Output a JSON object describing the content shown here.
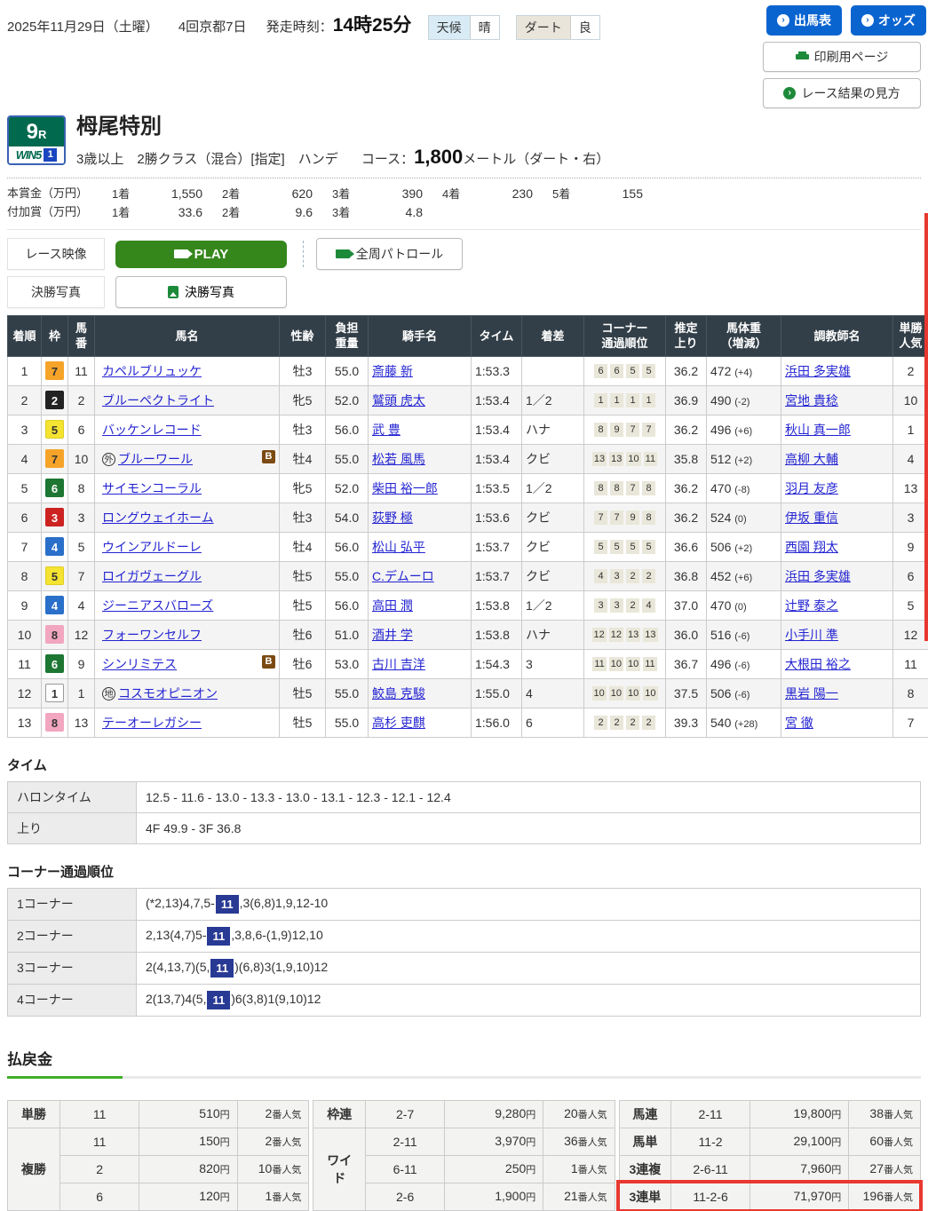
{
  "page": {
    "date": "2025年11月29日（土曜）",
    "meeting": "4回京都7日",
    "start_label": "発走時刻：",
    "start_time": "14時25分",
    "weather_label": "天候",
    "weather_value": "晴",
    "track_label": "ダート",
    "track_value": "良"
  },
  "actions": {
    "entries": "出馬表",
    "odds": "オッズ",
    "print": "印刷用ページ",
    "guide": "レース結果の見方"
  },
  "race": {
    "number": "9",
    "number_suffix": "R",
    "win5": "WIN5",
    "win5_num": "1",
    "title": "栂尾特別",
    "conditions": "3歳以上　2勝クラス（混合）[指定]　ハンデ",
    "course_label": "コース：",
    "course_value": "1,800",
    "course_suffix": "メートル（ダート・右）"
  },
  "prizes": {
    "main_label": "本賞金（万円）",
    "main": [
      [
        "1着",
        "1,550"
      ],
      [
        "2着",
        "620"
      ],
      [
        "3着",
        "390"
      ],
      [
        "4着",
        "230"
      ],
      [
        "5着",
        "155"
      ]
    ],
    "added_label": "付加賞（万円）",
    "added": [
      [
        "1着",
        "33.6"
      ],
      [
        "2着",
        "9.6"
      ],
      [
        "3着",
        "4.8"
      ]
    ]
  },
  "video": {
    "race_video_label": "レース映像",
    "play": "PLAY",
    "patrol": "全周パトロール",
    "photo_label": "決勝写真",
    "photo_button": "決勝写真"
  },
  "results": {
    "headers": [
      "着順",
      "枠",
      "馬\n番",
      "馬名",
      "性齢",
      "負担\n重量",
      "騎手名",
      "タイム",
      "着差",
      "コーナー\n通過順位",
      "推定\n上り",
      "馬体重\n（増減）",
      "調教師名",
      "単勝\n人気"
    ],
    "frame_colors": {
      "1": {
        "bg": "#ffffff",
        "fg": "#333333",
        "border": "#999999"
      },
      "2": {
        "bg": "#222222",
        "fg": "#ffffff",
        "border": "#222222"
      },
      "3": {
        "bg": "#cc2222",
        "fg": "#ffffff",
        "border": "#cc2222"
      },
      "4": {
        "bg": "#2a6fc9",
        "fg": "#ffffff",
        "border": "#2a6fc9"
      },
      "5": {
        "bg": "#f5e332",
        "fg": "#333333",
        "border": "#e0cd20"
      },
      "6": {
        "bg": "#1d7733",
        "fg": "#ffffff",
        "border": "#1d7733"
      },
      "7": {
        "bg": "#f6a429",
        "fg": "#333333",
        "border": "#f6a429"
      },
      "8": {
        "bg": "#f2a6c0",
        "fg": "#333333",
        "border": "#f2a6c0"
      }
    },
    "rows": [
      {
        "pos": "1",
        "frame": "7",
        "num": "11",
        "mark": "",
        "name": "カペルブリュッケ",
        "blinker": false,
        "sex_age": "牡3",
        "weight": "55.0",
        "jockey": "斎藤 新",
        "time": "1:53.3",
        "margin": "",
        "corners": [
          "6",
          "6",
          "5",
          "5"
        ],
        "last3f": "36.2",
        "body": "472",
        "diff": "(+4)",
        "trainer": "浜田 多実雄",
        "pop": "2"
      },
      {
        "pos": "2",
        "frame": "2",
        "num": "2",
        "mark": "",
        "name": "ブルーペクトライト",
        "blinker": false,
        "sex_age": "牝5",
        "weight": "52.0",
        "jockey": "鷲頭 虎太",
        "time": "1:53.4",
        "margin": "1／2",
        "corners": [
          "1",
          "1",
          "1",
          "1"
        ],
        "last3f": "36.9",
        "body": "490",
        "diff": "(-2)",
        "trainer": "宮地 貴稔",
        "pop": "10"
      },
      {
        "pos": "3",
        "frame": "5",
        "num": "6",
        "mark": "",
        "name": "バッケンレコード",
        "blinker": false,
        "sex_age": "牡3",
        "weight": "56.0",
        "jockey": "武 豊",
        "time": "1:53.4",
        "margin": "ハナ",
        "corners": [
          "8",
          "9",
          "7",
          "7"
        ],
        "last3f": "36.2",
        "body": "496",
        "diff": "(+6)",
        "trainer": "秋山 真一郎",
        "pop": "1"
      },
      {
        "pos": "4",
        "frame": "7",
        "num": "10",
        "mark": "外",
        "name": "ブルーワール",
        "blinker": true,
        "sex_age": "牡4",
        "weight": "55.0",
        "jockey": "松若 風馬",
        "time": "1:53.4",
        "margin": "クビ",
        "corners": [
          "13",
          "13",
          "10",
          "11"
        ],
        "last3f": "35.8",
        "body": "512",
        "diff": "(+2)",
        "trainer": "高柳 大輔",
        "pop": "4"
      },
      {
        "pos": "5",
        "frame": "6",
        "num": "8",
        "mark": "",
        "name": "サイモンコーラル",
        "blinker": false,
        "sex_age": "牝5",
        "weight": "52.0",
        "jockey": "柴田 裕一郎",
        "time": "1:53.5",
        "margin": "1／2",
        "corners": [
          "8",
          "8",
          "7",
          "8"
        ],
        "last3f": "36.2",
        "body": "470",
        "diff": "(-8)",
        "trainer": "羽月 友彦",
        "pop": "13"
      },
      {
        "pos": "6",
        "frame": "3",
        "num": "3",
        "mark": "",
        "name": "ロングウェイホーム",
        "blinker": false,
        "sex_age": "牡3",
        "weight": "54.0",
        "jockey": "荻野 極",
        "time": "1:53.6",
        "margin": "クビ",
        "corners": [
          "7",
          "7",
          "9",
          "8"
        ],
        "last3f": "36.2",
        "body": "524",
        "diff": "(0)",
        "trainer": "伊坂 重信",
        "pop": "3"
      },
      {
        "pos": "7",
        "frame": "4",
        "num": "5",
        "mark": "",
        "name": "ウインアルドーレ",
        "blinker": false,
        "sex_age": "牡4",
        "weight": "56.0",
        "jockey": "松山 弘平",
        "time": "1:53.7",
        "margin": "クビ",
        "corners": [
          "5",
          "5",
          "5",
          "5"
        ],
        "last3f": "36.6",
        "body": "506",
        "diff": "(+2)",
        "trainer": "西園 翔太",
        "pop": "9"
      },
      {
        "pos": "8",
        "frame": "5",
        "num": "7",
        "mark": "",
        "name": "ロイガヴェーグル",
        "blinker": false,
        "sex_age": "牡5",
        "weight": "55.0",
        "jockey": "C.デムーロ",
        "time": "1:53.7",
        "margin": "クビ",
        "corners": [
          "4",
          "3",
          "2",
          "2"
        ],
        "last3f": "36.8",
        "body": "452",
        "diff": "(+6)",
        "trainer": "浜田 多実雄",
        "pop": "6"
      },
      {
        "pos": "9",
        "frame": "4",
        "num": "4",
        "mark": "",
        "name": "ジーニアスバローズ",
        "blinker": false,
        "sex_age": "牡5",
        "weight": "56.0",
        "jockey": "高田 潤",
        "time": "1:53.8",
        "margin": "1／2",
        "corners": [
          "3",
          "3",
          "2",
          "4"
        ],
        "last3f": "37.0",
        "body": "470",
        "diff": "(0)",
        "trainer": "辻野 泰之",
        "pop": "5"
      },
      {
        "pos": "10",
        "frame": "8",
        "num": "12",
        "mark": "",
        "name": "フォーワンセルフ",
        "blinker": false,
        "sex_age": "牡6",
        "weight": "51.0",
        "jockey": "酒井 学",
        "time": "1:53.8",
        "margin": "ハナ",
        "corners": [
          "12",
          "12",
          "13",
          "13"
        ],
        "last3f": "36.0",
        "body": "516",
        "diff": "(-6)",
        "trainer": "小手川 準",
        "pop": "12"
      },
      {
        "pos": "11",
        "frame": "6",
        "num": "9",
        "mark": "",
        "name": "シンリミテス",
        "blinker": true,
        "sex_age": "牡6",
        "weight": "53.0",
        "jockey": "古川 吉洋",
        "time": "1:54.3",
        "margin": "3",
        "corners": [
          "11",
          "10",
          "10",
          "11"
        ],
        "last3f": "36.7",
        "body": "496",
        "diff": "(-6)",
        "trainer": "大根田 裕之",
        "pop": "11"
      },
      {
        "pos": "12",
        "frame": "1",
        "num": "1",
        "mark": "地",
        "name": "コスモオピニオン",
        "blinker": false,
        "sex_age": "牡5",
        "weight": "55.0",
        "jockey": "鮫島 克駿",
        "time": "1:55.0",
        "margin": "4",
        "corners": [
          "10",
          "10",
          "10",
          "10"
        ],
        "last3f": "37.5",
        "body": "506",
        "diff": "(-6)",
        "trainer": "黒岩 陽一",
        "pop": "8"
      },
      {
        "pos": "13",
        "frame": "8",
        "num": "13",
        "mark": "",
        "name": "テーオーレガシー",
        "blinker": false,
        "sex_age": "牡5",
        "weight": "55.0",
        "jockey": "高杉 吏麒",
        "time": "1:56.0",
        "margin": "6",
        "corners": [
          "2",
          "2",
          "2",
          "2"
        ],
        "last3f": "39.3",
        "body": "540",
        "diff": "(+28)",
        "trainer": "宮 徹",
        "pop": "7"
      }
    ]
  },
  "time_section": {
    "title": "タイム",
    "rows": [
      {
        "label": "ハロンタイム",
        "value": "12.5 - 11.6 - 13.0 - 13.3 - 13.0 - 13.1 - 12.3 - 12.1 - 12.4"
      },
      {
        "label": "上り",
        "value": "4F 49.9 - 3F 36.8"
      }
    ]
  },
  "corner_section": {
    "title": "コーナー通過順位",
    "highlight": "11",
    "rows": [
      {
        "label": "1コーナー",
        "pre": "(*2,13)4,7,5-",
        "post": ",3(6,8)1,9,12-10"
      },
      {
        "label": "2コーナー",
        "pre": "2,13(4,7)5-",
        "post": ",3,8,6-(1,9)12,10"
      },
      {
        "label": "3コーナー",
        "pre": "2(4,13,7)(5,",
        "post": ")(6,8)3(1,9,10)12"
      },
      {
        "label": "4コーナー",
        "pre": "2(13,7)4(5,",
        "post": ")6(3,8)1(9,10)12"
      }
    ]
  },
  "payout": {
    "title": "払戻金",
    "yen": "円",
    "pop_suffix": "番人気",
    "groups": [
      [
        {
          "type": "単勝",
          "rows": [
            {
              "combo": "11",
              "amount": "510",
              "pop": "2"
            }
          ]
        },
        {
          "type": "複勝",
          "rows": [
            {
              "combo": "11",
              "amount": "150",
              "pop": "2"
            },
            {
              "combo": "2",
              "amount": "820",
              "pop": "10"
            },
            {
              "combo": "6",
              "amount": "120",
              "pop": "1"
            }
          ]
        }
      ],
      [
        {
          "type": "枠連",
          "rows": [
            {
              "combo": "2-7",
              "amount": "9,280",
              "pop": "20"
            }
          ]
        },
        {
          "type": "ワイド",
          "rows": [
            {
              "combo": "2-11",
              "amount": "3,970",
              "pop": "36"
            },
            {
              "combo": "6-11",
              "amount": "250",
              "pop": "1"
            },
            {
              "combo": "2-6",
              "amount": "1,900",
              "pop": "21"
            }
          ]
        }
      ],
      [
        {
          "type": "馬連",
          "rows": [
            {
              "combo": "2-11",
              "amount": "19,800",
              "pop": "38"
            }
          ]
        },
        {
          "type": "馬単",
          "rows": [
            {
              "combo": "11-2",
              "amount": "29,100",
              "pop": "60"
            }
          ]
        },
        {
          "type": "3連複",
          "rows": [
            {
              "combo": "2-6-11",
              "amount": "7,960",
              "pop": "27"
            }
          ]
        },
        {
          "type": "3連単",
          "highlight": true,
          "rows": [
            {
              "combo": "11-2-6",
              "amount": "71,970",
              "pop": "196"
            }
          ]
        }
      ]
    ]
  }
}
